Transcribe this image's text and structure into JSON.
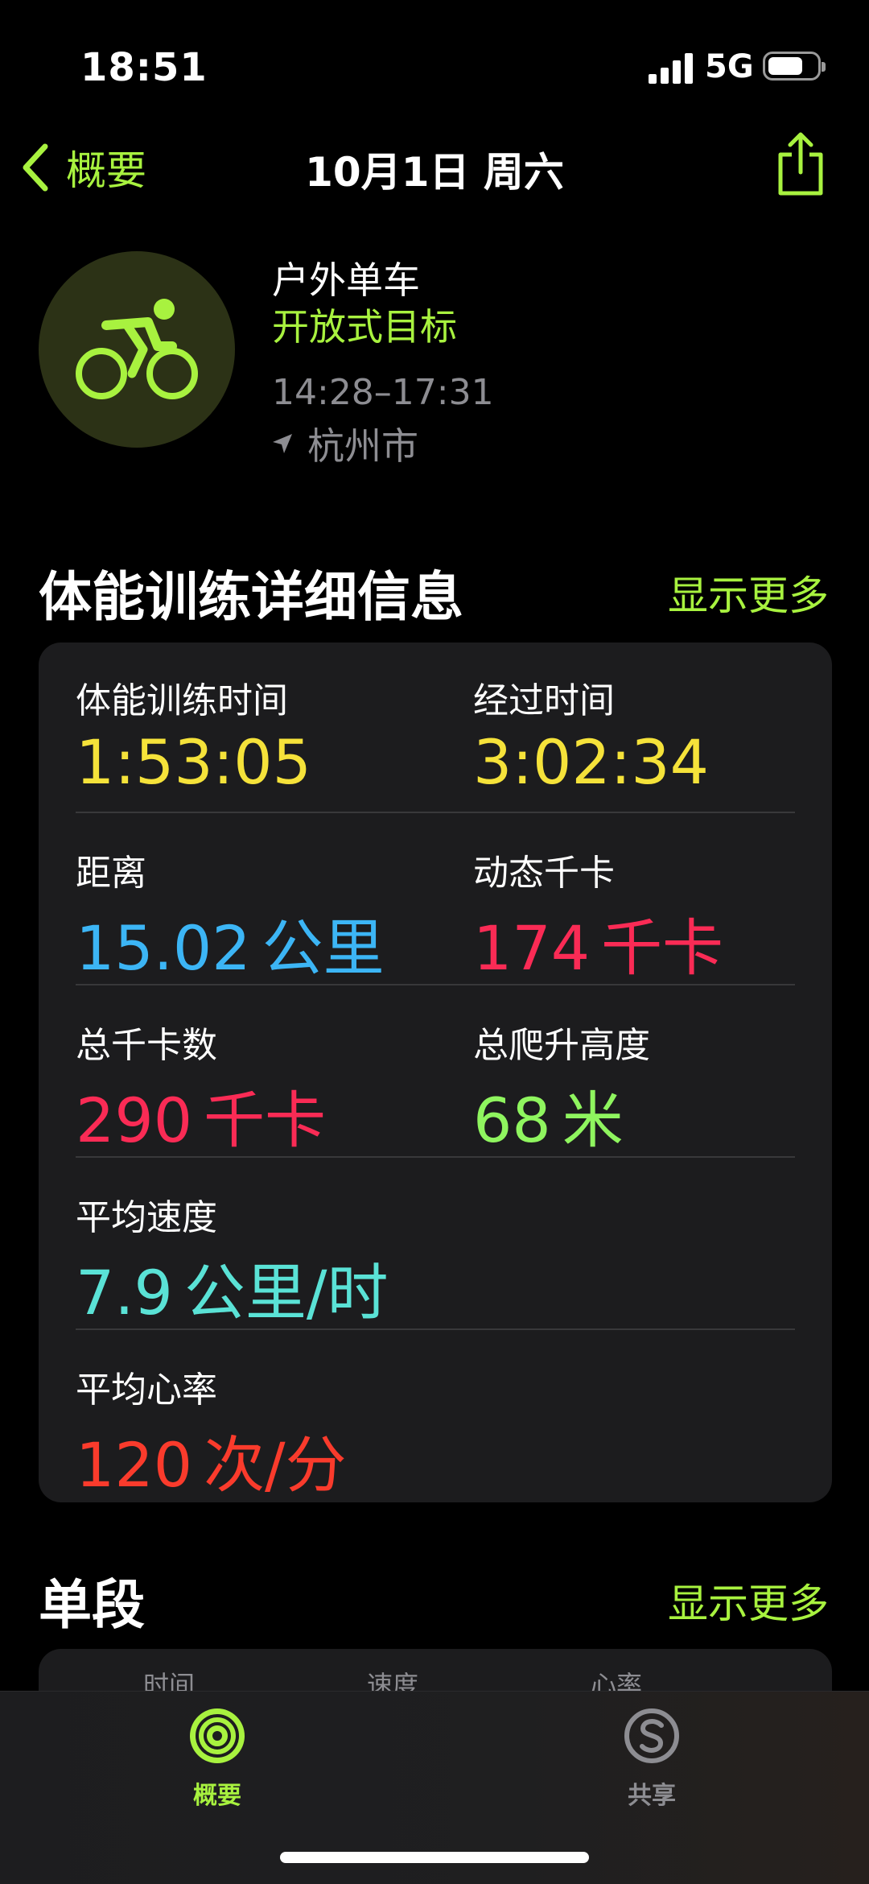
{
  "status_bar": {
    "time": "18:51",
    "network": "5G"
  },
  "nav": {
    "back_label": "概要",
    "title": "10月1日 周六"
  },
  "workout": {
    "type": "户外单车",
    "goal": "开放式目标",
    "time_range": "14:28–17:31",
    "location": "杭州市"
  },
  "details": {
    "title": "体能训练详细信息",
    "more_label": "显示更多",
    "metrics": [
      {
        "label": "体能训练时间",
        "value": "1:53:05",
        "unit": ""
      },
      {
        "label": "经过时间",
        "value": "3:02:34",
        "unit": ""
      },
      {
        "label": "距离",
        "value": "15.02",
        "unit": "公里"
      },
      {
        "label": "动态千卡",
        "value": "174",
        "unit": "千卡"
      },
      {
        "label": "总千卡数",
        "value": "290",
        "unit": "千卡"
      },
      {
        "label": "总爬升高度",
        "value": "68",
        "unit": "米"
      },
      {
        "label": "平均速度",
        "value": "7.9",
        "unit": "公里/时"
      },
      {
        "label": "平均心率",
        "value": "120",
        "unit": "次/分"
      }
    ]
  },
  "splits": {
    "title": "单段",
    "more_label": "显示更多",
    "columns": [
      "时间",
      "速度",
      "心率"
    ]
  },
  "tabs": [
    {
      "label": "概要",
      "icon": "activity-rings-icon",
      "active": true,
      "color": "#a8f23f"
    },
    {
      "label": "共享",
      "icon": "sharing-icon",
      "active": false,
      "color": "#8d8d92"
    }
  ],
  "colors": {
    "accent": "#a8f23f",
    "yellow": "#f5e23a",
    "blue": "#3cb5f5",
    "pink": "#fa2b55",
    "green": "#8ff55f",
    "cyan": "#5ae2d6",
    "red": "#fa3b2c"
  }
}
